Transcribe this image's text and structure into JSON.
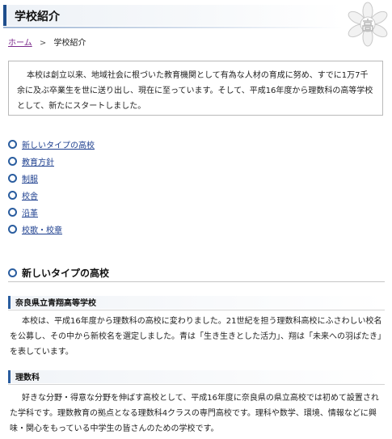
{
  "page": {
    "title": "学校紹介"
  },
  "breadcrumb": {
    "home": "ホーム",
    "separator": ">",
    "current": "学校紹介"
  },
  "intro": {
    "text": "本校は創立以来、地域社会に根づいた教育機関として有為な人材の育成に努め、すでに1万7千余に及ぶ卒業生を世に送り出し、現在に至っています。そして、平成16年度から理数科の高等学校として、新たにスタートしました。"
  },
  "nav": {
    "items": [
      {
        "label": "新しいタイプの高校"
      },
      {
        "label": "教育方針"
      },
      {
        "label": "制服"
      },
      {
        "label": "校舎"
      },
      {
        "label": "沿革"
      },
      {
        "label": "校歌・校章"
      }
    ]
  },
  "section": {
    "title": "新しいタイプの高校",
    "subsections": [
      {
        "heading": "奈良県立青翔高等学校",
        "body": "本校は、平成16年度から理数科の高校に変わりました。21世紀を担う理数科高校にふさわしい校名を公募し、その中から新校名を選定しました。青は「生き生きとした活力」、翔は「未来への羽ばたき」を表しています。"
      },
      {
        "heading": "理数科",
        "body": "好きな分野・得意な分野を伸ばす高校として、平成16年度に奈良県の県立高校では初めて設置された学科です。理数教育の拠点となる理数科4クラスの専門高校です。理科や数学、環境、情報などに興味・関心をもっている中学生の皆さんのための学校です。"
      }
    ]
  },
  "colors": {
    "accent": "#2a5d9f",
    "link": "#1d3f8f",
    "visited_link": "#7b2a8c"
  },
  "icons": {
    "emblem": "school-emblem-icon",
    "bullet": "circle-bullet-icon"
  }
}
